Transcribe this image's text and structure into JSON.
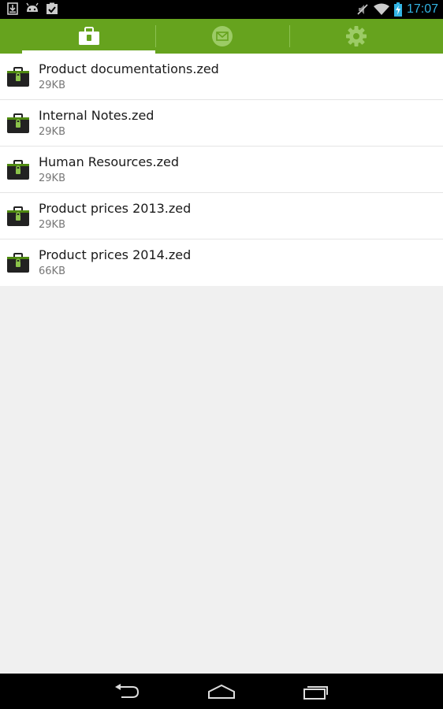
{
  "status_bar": {
    "icons_left": [
      "download-icon",
      "android-icon",
      "clipboard-check-icon"
    ],
    "icons_right": [
      "mute-icon",
      "wifi-icon",
      "battery-charging-icon"
    ],
    "time": "17:07"
  },
  "tabs": [
    {
      "icon": "briefcase-icon",
      "selected": true
    },
    {
      "icon": "mail-icon",
      "selected": false
    },
    {
      "icon": "gear-icon",
      "selected": false
    }
  ],
  "files": [
    {
      "name": "Product documentations.zed",
      "size": "29KB"
    },
    {
      "name": "Internal Notes.zed",
      "size": "29KB"
    },
    {
      "name": "Human Resources.zed",
      "size": "29KB"
    },
    {
      "name": "Product prices 2013.zed",
      "size": "29KB"
    },
    {
      "name": "Product prices 2014.zed",
      "size": "66KB"
    }
  ],
  "nav": [
    "back-icon",
    "home-icon",
    "recents-icon"
  ],
  "colors": {
    "accent": "#66a31e",
    "clock": "#33b5e5"
  }
}
